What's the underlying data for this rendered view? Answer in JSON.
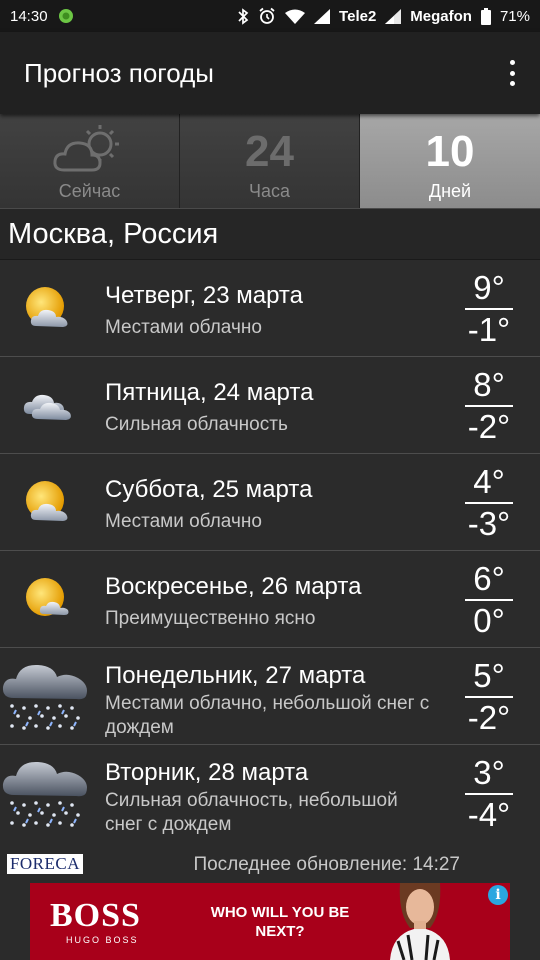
{
  "status_bar": {
    "time": "14:30",
    "carrier1": "Tele2",
    "carrier2": "Megafon",
    "battery": "71%",
    "icons": [
      "app-notification-icon",
      "bluetooth-icon",
      "alarm-icon",
      "wifi-icon",
      "signal-icon",
      "battery-icon"
    ]
  },
  "app_bar": {
    "title": "Прогноз погоды",
    "overflow_icon": "more-vert-icon"
  },
  "tabs": [
    {
      "big": "",
      "label": "Сейчас",
      "icon": "cloud-sun-icon",
      "selected": false
    },
    {
      "big": "24",
      "label": "Часа",
      "selected": false
    },
    {
      "big": "10",
      "label": "Дней",
      "selected": true
    }
  ],
  "location": "Москва, Россия",
  "forecast": [
    {
      "day": "Четверг, 23 марта",
      "desc": "Местами облачно",
      "high": "9°",
      "low": "-1°",
      "icon": "partly-cloudy-icon"
    },
    {
      "day": "Пятница, 24 марта",
      "desc": "Сильная облачность",
      "high": "8°",
      "low": "-2°",
      "icon": "cloudy-icon"
    },
    {
      "day": "Суббота, 25 марта",
      "desc": "Местами облачно",
      "high": "4°",
      "low": "-3°",
      "icon": "partly-cloudy-icon"
    },
    {
      "day": "Воскресенье, 26 марта",
      "desc": "Преимущественно ясно",
      "high": "6°",
      "low": "0°",
      "icon": "mostly-sunny-icon"
    },
    {
      "day": "Понедельник, 27 марта",
      "desc": "Местами облачно, небольшой снег с дождем",
      "high": "5°",
      "low": "-2°",
      "icon": "sleet-icon"
    },
    {
      "day": "Вторник, 28 марта",
      "desc": "Сильная облачность, небольшой снег с дождем",
      "high": "3°",
      "low": "-4°",
      "icon": "sleet-icon"
    }
  ],
  "footer": {
    "provider": "FORECA",
    "last_update": "Последнее обновление: 14:27"
  },
  "ad": {
    "brand": "BOSS",
    "sub_brand": "HUGO BOSS",
    "slogan": "WHO WILL YOU BE NEXT?",
    "info_icon": "info-icon",
    "info_glyph": "i",
    "colors": {
      "background": "#a8001a",
      "info": "#2aa7e0"
    }
  }
}
